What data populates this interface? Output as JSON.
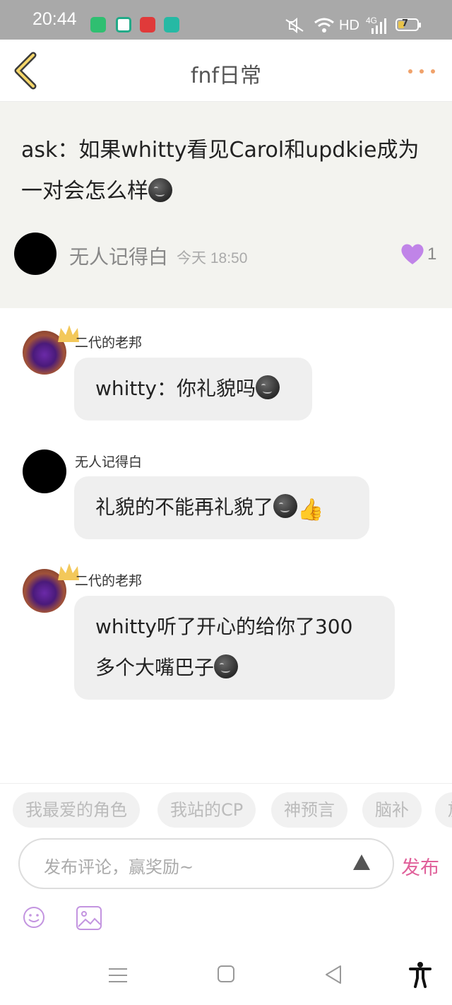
{
  "status_bar": {
    "time": "20:44",
    "network": "HD",
    "signal_label": "4G",
    "battery": "7",
    "app_icons": [
      "green-app-icon",
      "video-app-icon",
      "music-app-icon",
      "teal-app-icon"
    ]
  },
  "header": {
    "title": "fnf日常",
    "back_icon": "chevron-left-icon",
    "more_icon": "more-dots-icon"
  },
  "post": {
    "text": "ask：如果whitty看见Carol和updkie成为一对会怎么样",
    "author": "无人记得白",
    "time": "今天 18:50",
    "likes": "1",
    "accent_color": "#c084e8"
  },
  "comments": [
    {
      "author": "二代的老邦",
      "text": "whitty：你礼貌吗"
    },
    {
      "author": "无人记得白",
      "text": "礼貌的不能再礼貌了"
    },
    {
      "author": "二代的老邦",
      "text_line1": "whitty听了开心的给你了300",
      "text_line2": "多个大嘴巴子"
    }
  ],
  "tags": [
    "我最爱的角色",
    "我站的CP",
    "神预言",
    "脑补",
    "放"
  ],
  "composer": {
    "placeholder": "发布评论，赢奖励~",
    "publish_label": "发布",
    "publish_color": "#e0609a"
  }
}
